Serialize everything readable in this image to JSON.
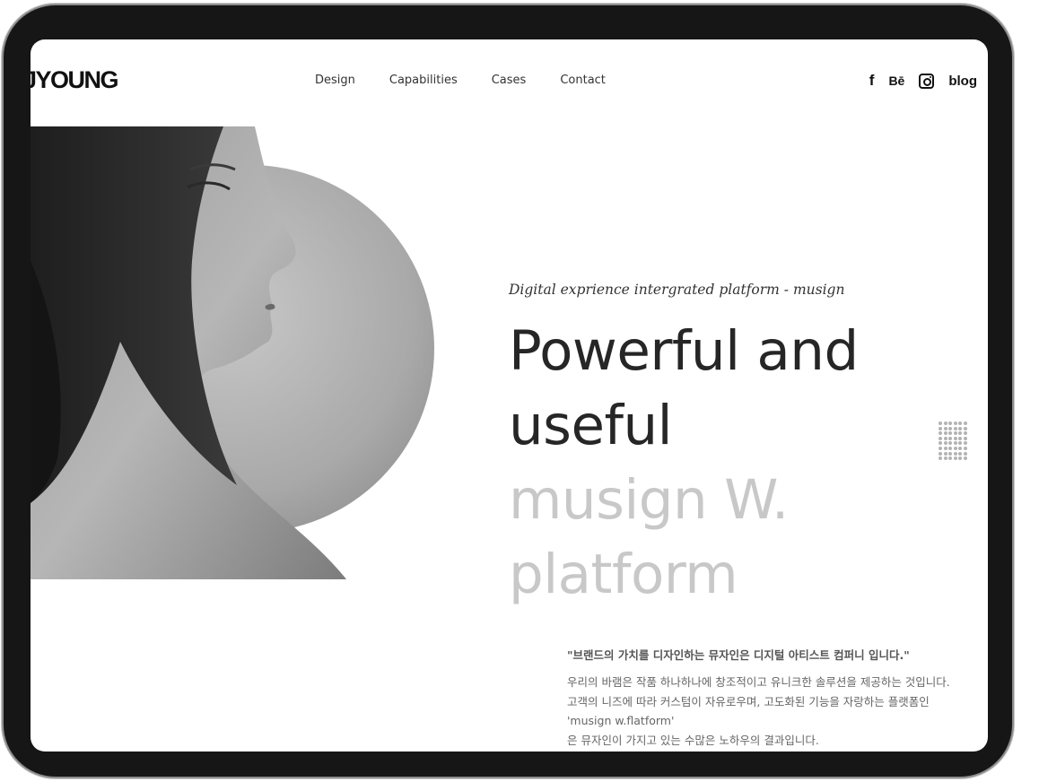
{
  "header": {
    "logo": "JYOUNG",
    "nav": [
      "Design",
      "Capabilities",
      "Cases",
      "Contact"
    ],
    "social": {
      "facebook": "f",
      "behance": "Bē",
      "blog": "blog"
    }
  },
  "hero": {
    "tagline": "Digital exprience intergrated platform - musign",
    "headline_line1": "Powerful and",
    "headline_line2": "useful",
    "headline_line3": "musign W.",
    "headline_line4": "platform",
    "quote": "\"브랜드의 가치를 디자인하는 뮤자인은 디지털 아티스트 컴퍼니 입니다.\"",
    "description": [
      "우리의 바램은 작품 하나하나에 창조적이고 유니크한 솔루션을 제공하는 것입니다.",
      "고객의 니즈에 따라 커스텀이 자유로우며, 고도화된 기능을 자랑하는 플랫폼인",
      "'musign w.flatform'",
      "은 뮤자인이 가지고 있는 수많은 노하우의 결과입니다."
    ]
  },
  "colors": {
    "bezel": "#161616",
    "headline": "#262626",
    "headline_muted": "#c8c8c8",
    "dots": "#b3b3b3"
  },
  "icons": [
    "facebook-icon",
    "behance-icon",
    "instagram-icon",
    "blog-icon",
    "dot-grid-icon"
  ]
}
